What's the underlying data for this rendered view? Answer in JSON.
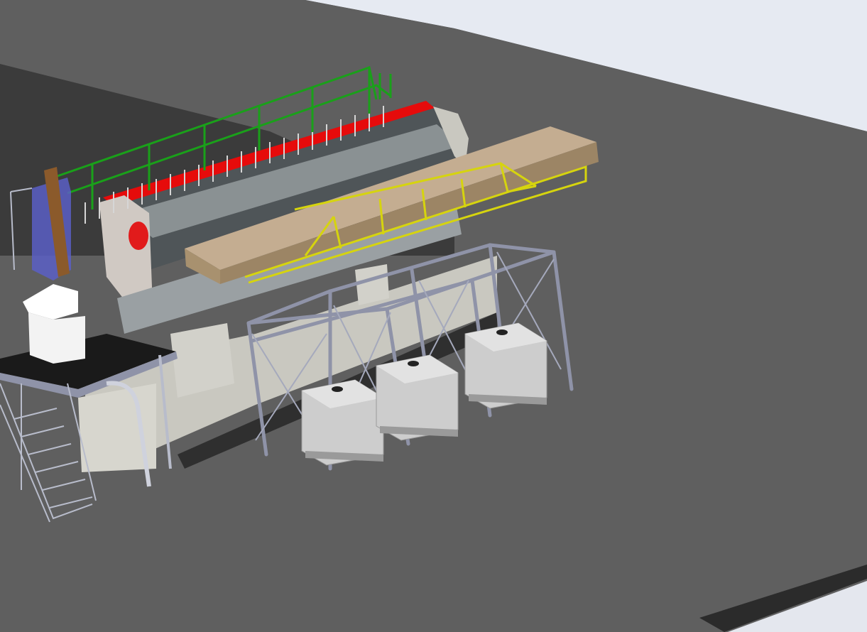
{
  "viewport": {
    "view_type": "3d-cad-model-viewport",
    "background_color": "#5f5f5f",
    "sky_color": "#e6eaf2"
  },
  "model": {
    "colors": {
      "floor": "#5f5f5f",
      "back_wall": "#3b3b3b",
      "drum": "#4f5558",
      "drum_highlight": "#8a9193",
      "drum_top_strip": "#e60b0b",
      "guard_rail": "#1aa01a",
      "support_frame": "#c9c8c0",
      "beam": "#b7a084",
      "yellow_truss": "#d6d40e",
      "rack_frame": "#8f93a8",
      "ibc_tank": "#cdcdcd",
      "control_cabinet": "#f3f3f3",
      "platform_top": "#1a1a1a",
      "stair_frame": "#b8bccb",
      "blue_frame": "#5a5fc6",
      "brown_post": "#8b5a2b"
    }
  }
}
